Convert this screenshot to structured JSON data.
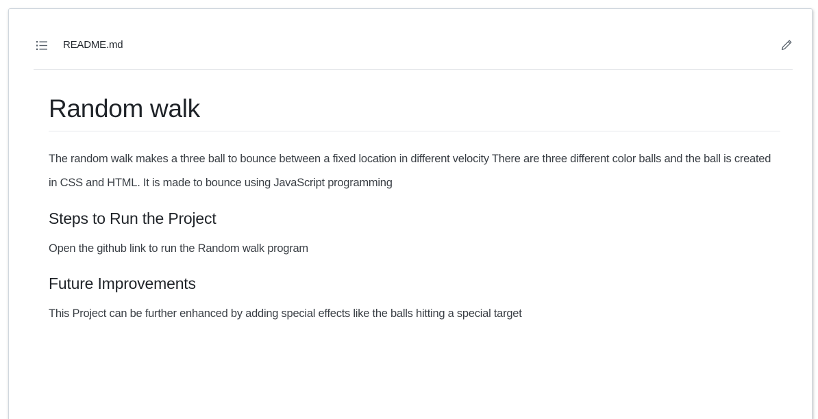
{
  "header": {
    "list_icon": "list-icon",
    "file_name": "README.md",
    "edit_icon": "pencil-icon"
  },
  "readme": {
    "title": "Random walk",
    "intro": "The random walk makes a three ball to bounce between a fixed location in different velocity There are three different color balls and the ball is created in CSS and HTML. It is made to bounce using JavaScript programming",
    "sections": [
      {
        "heading": "Steps to Run the Project",
        "text": "Open the github link to run the Random walk program"
      },
      {
        "heading": "Future Improvements",
        "text": "This Project can be further enhanced by adding special effects like the balls hitting a special target"
      }
    ]
  },
  "colors": {
    "text": "#24292f",
    "border": "#d0d7de",
    "icon": "#57606a"
  }
}
